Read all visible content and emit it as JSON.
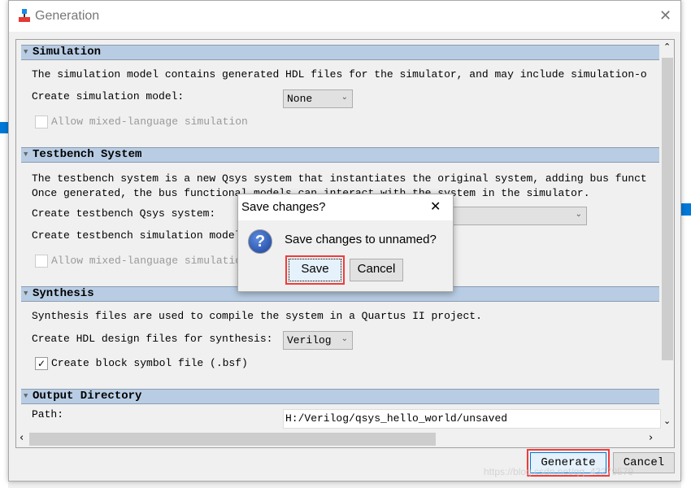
{
  "window": {
    "title": "Generation",
    "close_icon": "close-icon"
  },
  "sections": {
    "simulation": {
      "title": "Simulation",
      "description": "The simulation model contains generated HDL files for the simulator, and may include simulation-o",
      "model_label": "Create simulation model:",
      "model_value": "None",
      "mixed_label": "Allow mixed-language simulation",
      "mixed_checked": false
    },
    "testbench": {
      "title": "Testbench System",
      "description1": "The testbench system is a new Qsys system that instantiates the original system, adding bus funct",
      "description2": "Once generated, the bus functional models can interact with the system in the simulator.",
      "qsys_label": "Create testbench Qsys system:",
      "sim_label": "Create testbench simulation model:",
      "mixed_label": "Allow mixed-language simulation",
      "mixed_checked": false
    },
    "synthesis": {
      "title": "Synthesis",
      "description": "Synthesis files are used to compile the system in a Quartus II project.",
      "hdl_label": "Create HDL design files for synthesis:",
      "hdl_value": "Verilog",
      "bsf_label": "Create block symbol file (.bsf)",
      "bsf_checked": true
    },
    "output": {
      "title": "Output Directory",
      "path_label": "Path:",
      "path_value": "H:/Verilog/qsys_hello_world/unsaved"
    }
  },
  "buttons": {
    "generate": "Generate",
    "cancel": "Cancel"
  },
  "save_dialog": {
    "title": "Save changes?",
    "message": "Save changes to unnamed?",
    "save": "Save",
    "cancel": "Cancel",
    "icon": "question-icon"
  },
  "watermark": "https://blog.csdn.net/qq_43279579",
  "colors": {
    "section_header": "#b8cde4",
    "highlight": "#f23b3b"
  }
}
